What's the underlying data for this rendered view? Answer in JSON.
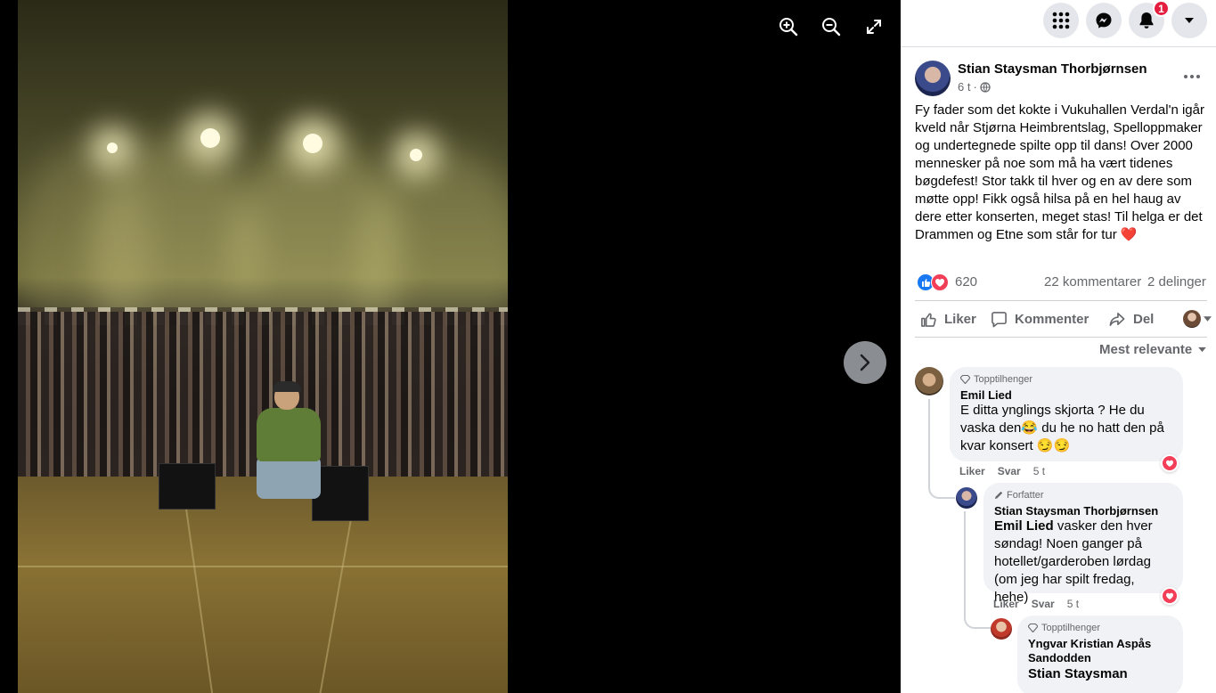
{
  "viewer": {
    "zoom_in_icon": "zoom-in-icon",
    "zoom_out_icon": "zoom-out-icon",
    "fullscreen_icon": "fullscreen-icon",
    "next_icon": "chevron-right-icon"
  },
  "topbar": {
    "menu_icon": "grid-menu-icon",
    "messenger_icon": "messenger-icon",
    "notifications_icon": "bell-icon",
    "notifications_count": "1",
    "account_icon": "caret-down-icon"
  },
  "post": {
    "author": "Stian Staysman Thorbjørnsen",
    "time": "6 t",
    "separator": "·",
    "audience_icon": "globe-icon",
    "text": "Fy fader som det kokte i Vukuhallen Verdal'n igår kveld når Stjørna Heimbrentslag, Spelloppmaker og undertegnede spilte opp til dans! Over 2000 mennesker på noe som må ha vært tidenes bøgdefest! Stor takk til hver og en av dere som møtte opp! Fikk også hilsa på en hel haug av dere etter konserten, meget stas! Til helga er det Drammen og Etne som står for tur ❤️",
    "reaction_count": "620",
    "comments_count": "22 kommentarer",
    "shares_count": "2 delinger",
    "like_label": "Liker",
    "comment_label": "Kommenter",
    "share_label": "Del",
    "sort_label": "Mest relevante",
    "colors": {
      "like_blue": "#1877f2",
      "love_red": "#f33e58"
    }
  },
  "comments": [
    {
      "badge": "Topptilhenger",
      "author": "Emil Lied",
      "text": "E ditta ynglings skjorta ? He du vaska den😂 du he no hatt den på kvar konsert 😏😏",
      "like": "Liker",
      "reply": "Svar",
      "time": "5 t"
    },
    {
      "badge": "Forfatter",
      "author": "Stian Staysman Thorbjørnsen",
      "mention": "Emil Lied",
      "text": " vasker den hver søndag! Noen ganger på hotellet/garderoben lørdag (om jeg har spilt fredag, hehe)",
      "like": "Liker",
      "reply": "Svar",
      "time": "5 t"
    },
    {
      "badge": "Topptilhenger",
      "author": "Yngvar Kristian Aspås Sandodden",
      "mention": "Stian Staysman"
    }
  ]
}
